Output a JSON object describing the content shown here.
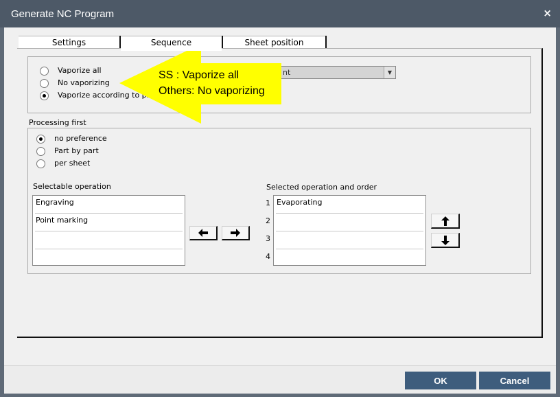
{
  "window": {
    "title": "Generate NC Program",
    "close_icon": "×"
  },
  "tabs": [
    {
      "label": "Settings"
    },
    {
      "label": "Sequence",
      "active": true
    },
    {
      "label": "Sheet position"
    }
  ],
  "vaporize": {
    "options": [
      {
        "label": "Vaporize all",
        "checked": false
      },
      {
        "label": "No vaporizing",
        "checked": false
      },
      {
        "label": "Vaporize according to pr",
        "checked": true
      }
    ],
    "combo_value": "nt"
  },
  "processing_first": {
    "label": "Processing first",
    "options": [
      {
        "label": "no preference",
        "checked": true
      },
      {
        "label": "Part by part",
        "checked": false
      },
      {
        "label": "per sheet",
        "checked": false
      }
    ]
  },
  "selectable_operation": {
    "label": "Selectable operation",
    "items": [
      "Engraving",
      "Point marking",
      "",
      ""
    ]
  },
  "selected_operation": {
    "label": "Selected operation and order",
    "numbers": [
      "1",
      "2",
      "3",
      "4"
    ],
    "items": [
      "Evaporating",
      "",
      "",
      ""
    ]
  },
  "callout": {
    "line1": "SS : Vaporize all",
    "line2": "Others: No vaporizing",
    "color": "#ffff00"
  },
  "footer": {
    "ok_label": "OK",
    "cancel_label": "Cancel"
  },
  "colors": {
    "titlebar": "#4d5967",
    "primary_button": "#3e5d7d",
    "frame": "#5f6a77"
  }
}
